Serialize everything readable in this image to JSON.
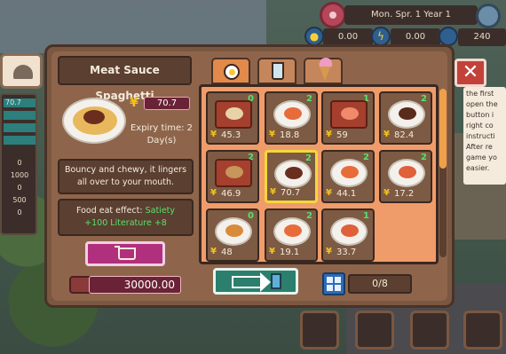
{
  "hud": {
    "date": "Mon. Spr. 1   Year 1",
    "stats": [
      "0.00",
      "0.00",
      "240"
    ],
    "left_bars": [
      "70.7",
      "",
      "",
      ""
    ],
    "left_numbers": [
      "0",
      "1000",
      "0",
      "500",
      "0"
    ]
  },
  "right_text": [
    "the first",
    "open the",
    "button i",
    "right co",
    "instructi",
    "After re",
    "game yo",
    "easier."
  ],
  "item": {
    "name": "Meat Sauce Spaghetti",
    "price": "70.7",
    "expiry": "Expiry time: 2 Day(s)",
    "description": "Bouncy and chewy, it lingers all over to your mouth.",
    "effect_label": "Food eat effect:",
    "effect_stat": "Satiety",
    "effect_values": "+100  Literature +8"
  },
  "wallet": {
    "amount": "30000.00"
  },
  "capacity": {
    "label": "0/8"
  },
  "tabs": [
    {
      "name": "breakfast",
      "icon": "fried-egg-icon"
    },
    {
      "name": "drink",
      "icon": "cup-icon"
    },
    {
      "name": "dessert",
      "icon": "ice-cream-icon"
    }
  ],
  "grid": [
    {
      "count": "0",
      "price": "45.3",
      "food": "box",
      "color": "#e8d3a8"
    },
    {
      "count": "2",
      "price": "18.8",
      "food": "plate",
      "color": "#e86b3a"
    },
    {
      "count": "1",
      "price": "59",
      "food": "box",
      "color": "#f08a6a"
    },
    {
      "count": "2",
      "price": "82.4",
      "food": "plate",
      "color": "#5a2a1a"
    },
    {
      "count": "2",
      "price": "46.9",
      "food": "box",
      "color": "#c8955a"
    },
    {
      "count": "2",
      "price": "70.7",
      "food": "plate",
      "color": "#6b2e1e"
    },
    {
      "count": "2",
      "price": "44.1",
      "food": "plate",
      "color": "#e86b3a"
    },
    {
      "count": "2",
      "price": "17.2",
      "food": "plate",
      "color": "#e0603a"
    },
    {
      "count": "0",
      "price": "48",
      "food": "plate",
      "color": "#d98b3a"
    },
    {
      "count": "2",
      "price": "19.1",
      "food": "plate",
      "color": "#e86b3a"
    },
    {
      "count": "1",
      "price": "33.7",
      "food": "plate",
      "color": "#e0603a"
    }
  ],
  "colors": {
    "accent": "#f3d83a",
    "grid_bg": "#f09c6a",
    "window": "#7a5741"
  }
}
